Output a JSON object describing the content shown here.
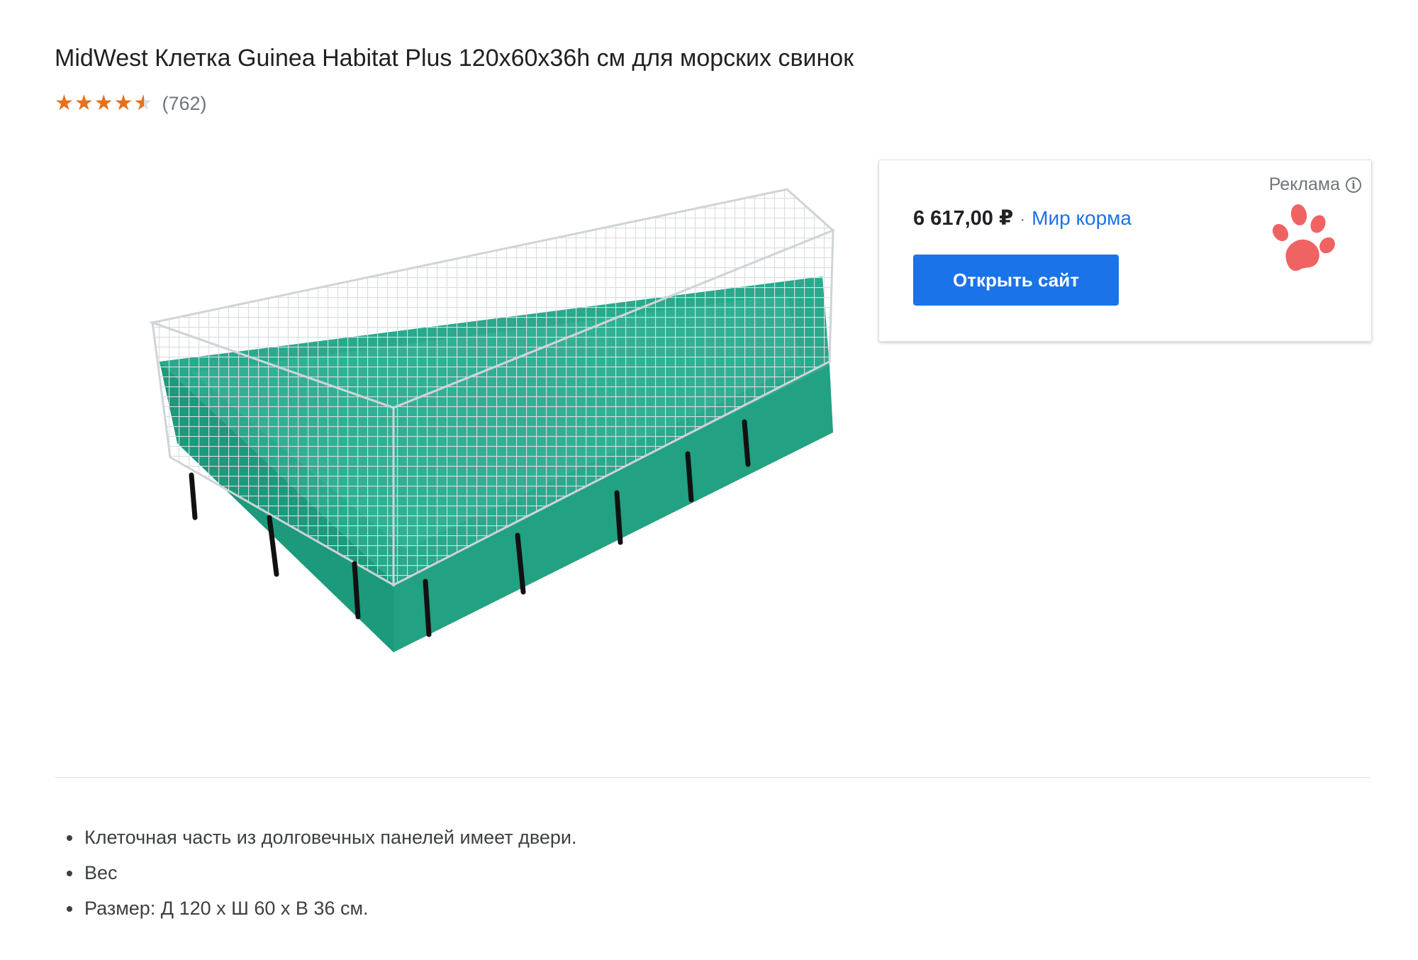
{
  "product": {
    "title": "MidWest Клетка Guinea Habitat Plus 120x60x36h см для морских свинок",
    "rating": {
      "stars_display": "★★★★★",
      "value": 4.5,
      "max": 5,
      "review_count": "(762)"
    },
    "image_alt": "Клетка для морских свинок с зелёным основанием"
  },
  "ad": {
    "label": "Реклама",
    "info_icon": "info-icon",
    "price": "6 617,00 ₽",
    "separator": "·",
    "merchant": "Мир корма",
    "button_label": "Открыть сайт",
    "logo_icon": "paw-icon",
    "colors": {
      "button": "#1a73e8",
      "merchant_link": "#1a73e8",
      "logo": "#f06363"
    }
  },
  "features": [
    "Клеточная часть из долговечных панелей имеет двери.",
    "Вес",
    "Размер: Д 120 х Ш 60 х В 36 см."
  ],
  "colors": {
    "star_filled": "#e7711b",
    "star_empty": "#dadce0",
    "cage_base": "#1fa083"
  }
}
